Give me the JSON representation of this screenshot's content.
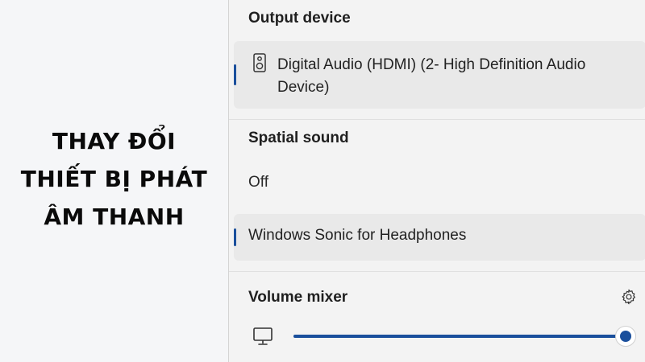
{
  "caption": {
    "lines": [
      "THAY ĐỔI",
      "THIẾT BỊ PHÁT",
      "ÂM THANH"
    ]
  },
  "panel": {
    "output_device": {
      "title": "Output device",
      "selected_device": {
        "label": "Digital Audio (HDMI) (2- High Definition Audio Device)",
        "icon": "speaker-icon"
      }
    },
    "spatial_sound": {
      "title": "Spatial sound",
      "options": [
        "Off",
        "Windows Sonic for Headphones"
      ],
      "selected": "Windows Sonic for Headphones"
    },
    "volume_mixer": {
      "title": "Volume mixer",
      "settings_icon": "gear-icon",
      "device_icon": "monitor-icon",
      "volume_fraction": 1.0
    }
  },
  "colors": {
    "accent": "#1a4f9c",
    "panel_bg": "#f3f3f3",
    "item_bg": "#e9e9e9"
  }
}
